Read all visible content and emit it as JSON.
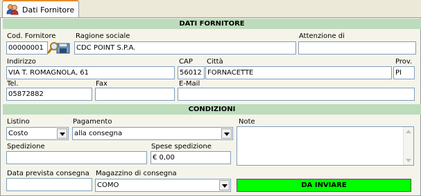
{
  "tab": {
    "label": "Dati Fornitore",
    "icon": "people-icon"
  },
  "sections": {
    "supplier": "DATI FORNITORE",
    "conditions": "CONDIZIONI"
  },
  "supplier": {
    "code_label": "Cod. Fornitore",
    "code_value": "00000001",
    "name_label": "Ragione sociale",
    "name_value": "CDC POINT S.P.A.",
    "attention_label": "Attenzione di",
    "attention_value": "",
    "address_label": "Indirizzo",
    "address_value": "VIA T. ROMAGNOLA, 61",
    "cap_label": "CAP",
    "cap_value": "56012",
    "city_label": "Città",
    "city_value": "FORNACETTE",
    "prov_label": "Prov.",
    "prov_value": "PI",
    "tel_label": "Tel.",
    "tel_value": "05872882",
    "fax_label": "Fax",
    "fax_value": "",
    "email_label": "E-Mail",
    "email_value": ""
  },
  "conditions": {
    "listino_label": "Listino",
    "listino_value": "Costo",
    "pagamento_label": "Pagamento",
    "pagamento_value": "alla consegna",
    "note_label": "Note",
    "note_value": "",
    "spedizione_label": "Spedizione",
    "spedizione_value": "",
    "spese_label": "Spese spedizione",
    "spese_value": "€ 0,00",
    "data_label": "Data prevista consegna",
    "data_value": "",
    "magazzino_label": "Magazzino di consegna",
    "magazzino_value": "COMO",
    "status": "DA INVIARE",
    "status_color": "#00ff00"
  }
}
